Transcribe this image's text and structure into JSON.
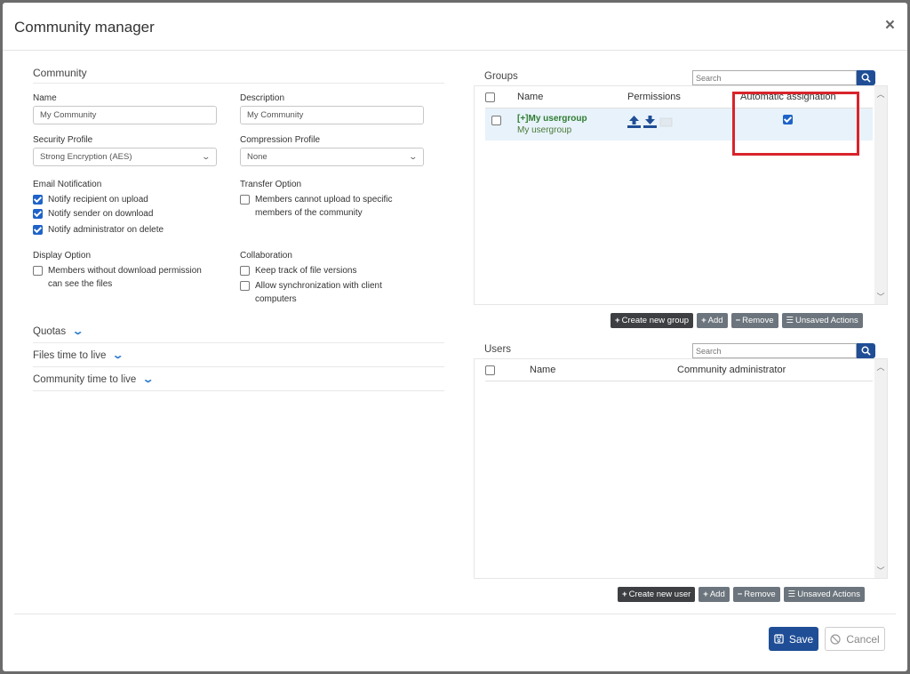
{
  "modal": {
    "title": "Community manager",
    "close_label": "×"
  },
  "community": {
    "section_title": "Community",
    "name": {
      "label": "Name",
      "value": "My Community"
    },
    "description": {
      "label": "Description",
      "value": "My Community"
    },
    "security_profile": {
      "label": "Security Profile",
      "value": "Strong Encryption (AES)"
    },
    "compression_profile": {
      "label": "Compression Profile",
      "value": "None"
    },
    "email_notification": {
      "label": "Email Notification",
      "options": [
        {
          "label": "Notify recipient on upload",
          "checked": true
        },
        {
          "label": "Notify sender on download",
          "checked": true
        },
        {
          "label": "Notify administrator on delete",
          "checked": true
        }
      ]
    },
    "transfer_option": {
      "label": "Transfer Option",
      "options": [
        {
          "label": "Members cannot upload to specific members of the community",
          "checked": false
        }
      ]
    },
    "display_option": {
      "label": "Display Option",
      "options": [
        {
          "label": "Members without download permission can see the files",
          "checked": false
        }
      ]
    },
    "collaboration": {
      "label": "Collaboration",
      "options": [
        {
          "label": "Keep track of file versions",
          "checked": false
        },
        {
          "label": "Allow synchronization with client computers",
          "checked": false
        }
      ]
    },
    "collapsibles": [
      "Quotas",
      "Files time to live",
      "Community time to live"
    ]
  },
  "groups": {
    "title": "Groups",
    "search_placeholder": "Search",
    "columns": [
      "Name",
      "Permissions",
      "Automatic assignation"
    ],
    "rows": [
      {
        "name": "[+]My usergroup",
        "subtitle": "My usergroup",
        "permissions": [
          "upload-icon",
          "download-icon",
          "email-icon"
        ],
        "automatic_assignation": true,
        "checked": false
      }
    ],
    "buttons": {
      "create": "Create new group",
      "add": "Add",
      "remove": "Remove",
      "unsaved": "Unsaved Actions"
    }
  },
  "users": {
    "title": "Users",
    "search_placeholder": "Search",
    "columns": [
      "Name",
      "Community administrator"
    ],
    "rows": [],
    "buttons": {
      "create": "Create new user",
      "add": "Add",
      "remove": "Remove",
      "unsaved": "Unsaved Actions"
    }
  },
  "footer": {
    "save": "Save",
    "cancel": "Cancel"
  },
  "colors": {
    "primary": "#1f4e96",
    "checkbox": "#1e63c9",
    "highlight": "#d9232b",
    "group_name": "#2e7d32"
  }
}
